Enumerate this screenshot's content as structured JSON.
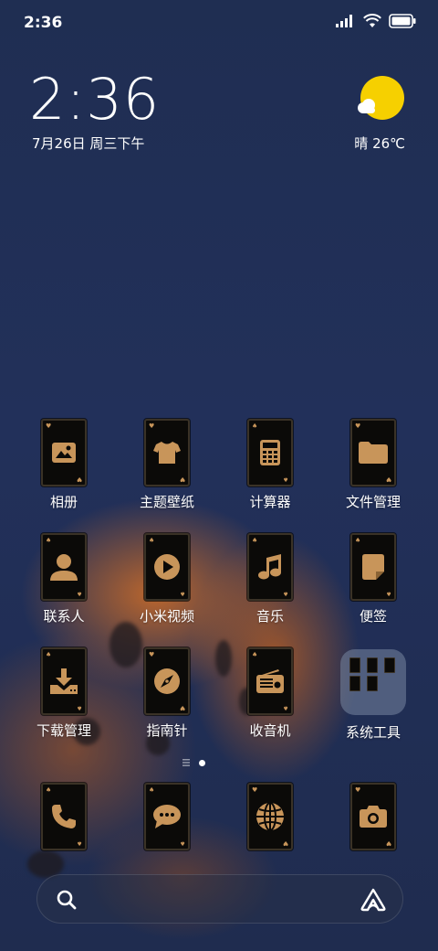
{
  "status_bar": {
    "time": "2:36",
    "icons": [
      "signal-icon",
      "wifi-icon",
      "battery-icon"
    ]
  },
  "clock_widget": {
    "time": "2:36",
    "date": "7月26日 周三下午"
  },
  "weather_widget": {
    "condition": "晴",
    "temperature": "晴 26℃",
    "icon": "sun-cloud-icon"
  },
  "apps": [
    {
      "label": "相册",
      "icon": "image-icon"
    },
    {
      "label": "主题壁纸",
      "icon": "tshirt-icon"
    },
    {
      "label": "计算器",
      "icon": "calculator-icon"
    },
    {
      "label": "文件管理",
      "icon": "folder-icon"
    },
    {
      "label": "联系人",
      "icon": "person-icon"
    },
    {
      "label": "小米视频",
      "icon": "play-icon"
    },
    {
      "label": "音乐",
      "icon": "music-note-icon"
    },
    {
      "label": "便签",
      "icon": "note-icon"
    },
    {
      "label": "下载管理",
      "icon": "download-icon"
    },
    {
      "label": "指南针",
      "icon": "compass-icon"
    },
    {
      "label": "收音机",
      "icon": "radio-icon"
    },
    {
      "label": "系统工具",
      "icon": "folder-group-icon"
    }
  ],
  "dock": [
    {
      "icon": "phone-icon"
    },
    {
      "icon": "message-icon"
    },
    {
      "icon": "globe-icon"
    },
    {
      "icon": "camera-icon"
    }
  ],
  "page_indicator": {
    "pages": 2,
    "current": 2
  },
  "colors": {
    "background": "#1f2e52",
    "icon_gold": "#c8955a",
    "card_black": "#0b0a08",
    "sun_yellow": "#f6d000"
  }
}
